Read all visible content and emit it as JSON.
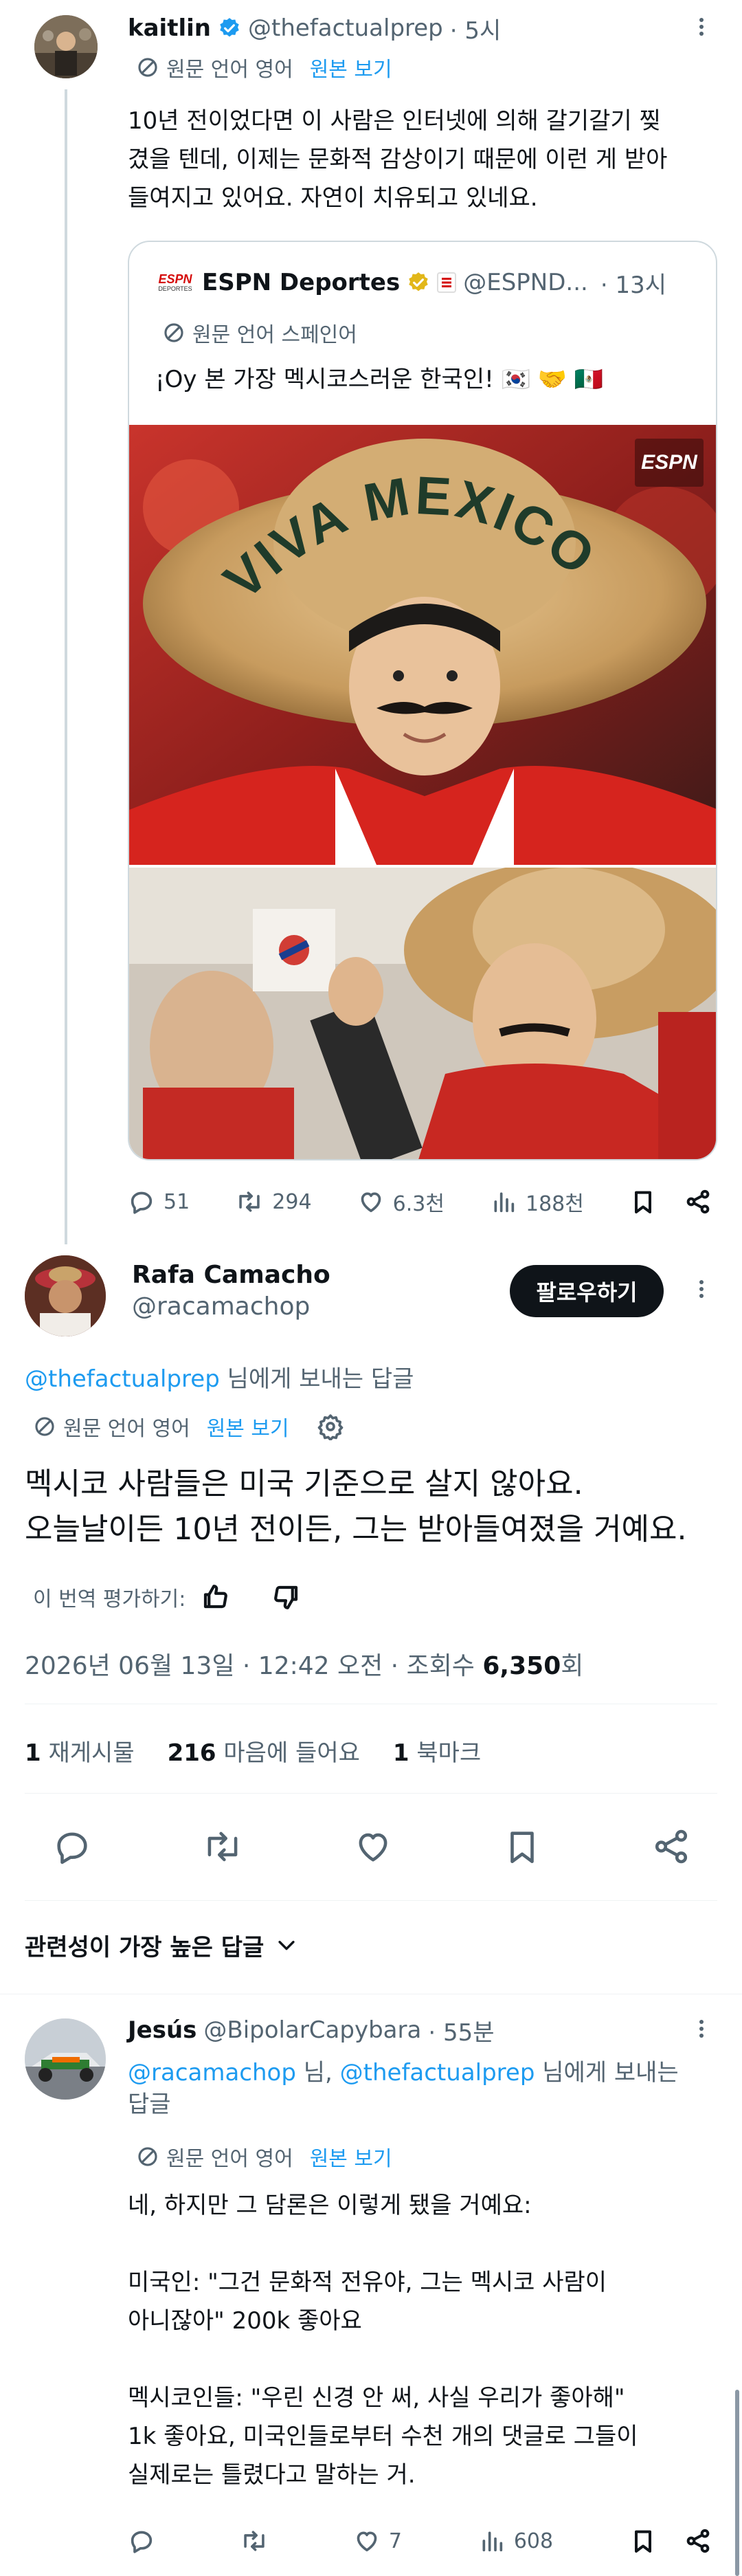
{
  "main_tweet": {
    "author_name": "kaitlin",
    "author_handle": "@thefactualprep",
    "time": "· 5시",
    "translation_note": "원문 언어 영어",
    "view_original": "원본 보기",
    "text": "10년 전이었다면 이 사람은 인터넷에 의해 갈기갈기 찢겼을 텐데, 이제는 문화적 감상이기 때문에 이런 게 받아들여지고 있어요. 자연이 치유되고 있네요.",
    "quote": {
      "author_name": "ESPN Deportes",
      "author_handle": "@ESPND...",
      "time": "· 13시",
      "logo_text": "ESPN",
      "logo_sub": "DEPORTES",
      "translation_note": "원문 언어 스페인어",
      "text": "¡Oy 본 가장 멕시코스러운 한국인! 🇰🇷 🤝 🇲🇽",
      "image_watermark": "ESPN",
      "hat_text": "VIVA MEXICO"
    },
    "actions": {
      "replies": "51",
      "retweets": "294",
      "likes": "6.3천",
      "views": "188천"
    }
  },
  "focus_tweet": {
    "author_name": "Rafa Camacho",
    "author_handle": "@racamachop",
    "follow_label": "팔로우하기",
    "reply_to_handle": "@thefactualprep",
    "reply_to_suffix": " 님에게 보내는 답글",
    "translation_note": "원문 언어 영어",
    "view_original": "원본 보기",
    "text_line1": "멕시코 사람들은 미국 기준으로 살지 않아요.",
    "text_line2": "오늘날이든 10년 전이든, 그는 받아들여졌을 거예요.",
    "rate_translation": "이 번역 평가하기:",
    "meta_date": "2026년 06월 13일 · 12:42 오전 · 조회수 ",
    "meta_views": "6,350",
    "meta_views_suffix": "회",
    "stats": {
      "retweets_num": "1",
      "retweets_label": "재게시물",
      "likes_num": "216",
      "likes_label": "마음에 들어요",
      "bookmarks_num": "1",
      "bookmarks_label": "북마크"
    }
  },
  "sort_label": "관련성이 가장 높은 답글",
  "reply": {
    "author_name": "Jesús",
    "author_handle": "@BipolarCapybara",
    "time": "· 55분",
    "reply_to_handle1": "@racamachop",
    "reply_to_mid": " 님, ",
    "reply_to_handle2": "@thefactualprep",
    "reply_to_suffix": " 님에게 보내는",
    "reply_to_suffix2": "답글",
    "translation_note": "원문 언어 영어",
    "view_original": "원본 보기",
    "p1": "네, 하지만 그 담론은 이렇게 됐을 거예요:",
    "p2a": "미국인: \"그건 문화적 전유야, 그는 멕시코 사람이",
    "p2b": "아니잖아\" 200k 좋아요",
    "p3a": "멕시코인들: \"우린 신경 안 써, 사실 우리가 좋아해\"",
    "p3b": "1k 좋아요, 미국인들로부터 수천 개의 댓글로 그들이",
    "p3c": "실제로는 틀렸다고 말하는 거.",
    "actions": {
      "replies": "",
      "retweets": "",
      "likes": "7",
      "views": "608"
    }
  },
  "colors": {
    "accent": "#1d9bf0",
    "text": "#0f1419",
    "muted": "#536471",
    "verified_blue": "#1d9bf0",
    "verified_gold": "#e2b719"
  }
}
